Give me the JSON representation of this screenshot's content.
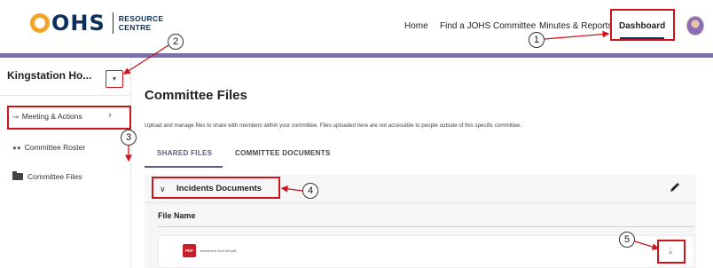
{
  "header": {
    "logo_main": "OHS",
    "logo_sub_line1": "RESOURCE",
    "logo_sub_line2": "CENTRE",
    "nav": {
      "home": "Home",
      "find": "Find a JOHS Committee",
      "minutes": "Minutes & Reports",
      "dashboard": "Dashboard"
    },
    "accent": "#0d2f5b",
    "bar_color": "#7a6fa8"
  },
  "sidebar": {
    "site_name": "Kingstation Ho...",
    "items": [
      {
        "label": "Meeting & Actions",
        "icon": "meeting-icon"
      },
      {
        "label": "Committee Roster",
        "icon": "people-icon"
      },
      {
        "label": "Committee Files",
        "icon": "folder-icon"
      }
    ]
  },
  "main": {
    "title": "Committee Files",
    "description": "Upload and manage files to share with members within your committee. Files uploaded here are not accessible to people outside of this specific committee.",
    "tabs": [
      {
        "label": "SHARED FILES",
        "active": true
      },
      {
        "label": "COMMITTEE DOCUMENTS",
        "active": false
      }
    ],
    "section": {
      "title": "Incidents Documents",
      "column_header": "File Name",
      "files": [
        {
          "name": "Incident in floor 6th.pdf",
          "badge": "PDF"
        }
      ]
    }
  },
  "callouts": [
    "1",
    "2",
    "3",
    "4",
    "5"
  ],
  "highlight_color": "#d0121b"
}
